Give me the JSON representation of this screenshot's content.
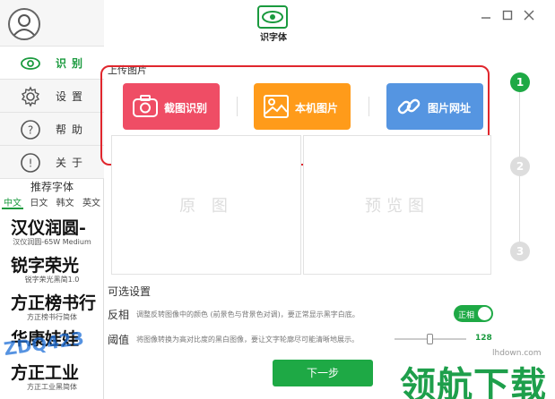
{
  "app": {
    "title": "识字体"
  },
  "sidebar": {
    "items": [
      {
        "label": "识别",
        "icon": "eye-icon",
        "active": true
      },
      {
        "label": "设置",
        "icon": "gear-icon",
        "active": false
      },
      {
        "label": "帮助",
        "icon": "help-icon",
        "active": false
      },
      {
        "label": "关于",
        "icon": "info-icon",
        "active": false
      }
    ],
    "recommend_title": "推荐字体",
    "lang_tabs": [
      "中文",
      "日文",
      "韩文",
      "英文"
    ],
    "fonts": [
      {
        "sample": "汉仪润圆-",
        "name": "汉仪润圆-65W Medium"
      },
      {
        "sample": "锐字荣光",
        "name": "锐字荣光黑简1.0"
      },
      {
        "sample": "方正榜书行",
        "name": "方正榜书行简体"
      },
      {
        "sample": "华康娃娃",
        "name": ""
      },
      {
        "sample": "方正工业",
        "name": "方正工业黑简体"
      }
    ]
  },
  "upload": {
    "section_title": "上传图片",
    "buttons": [
      {
        "label": "截图识别",
        "icon": "camera-icon",
        "color": "#ef4d65"
      },
      {
        "label": "本机图片",
        "icon": "image-icon",
        "color": "#ff9b1a"
      },
      {
        "label": "图片网址",
        "icon": "link-icon",
        "color": "#5595e1"
      }
    ]
  },
  "preview": {
    "original": "原 图",
    "result": "预览图"
  },
  "options": {
    "title": "可选设置",
    "invert": {
      "name": "反相",
      "desc": "调整反转图像中的颜色 (前景色与背景色对调)，要正常显示黑字白底。",
      "toggle_label": "正相"
    },
    "threshold": {
      "name": "阈值",
      "desc": "将图像转换为高对比度的黑白图像，要让文字轮廓尽可能清晰地展示。",
      "value": "128",
      "value_fraction": 0.5
    }
  },
  "next_button": "下一步",
  "steps": [
    "1",
    "2",
    "3"
  ],
  "watermark": {
    "url": "lhdown.com",
    "text": "领航下载",
    "side": "ZDQ423"
  },
  "colors": {
    "accent": "#1ea945",
    "highlight": "#e0262d"
  }
}
